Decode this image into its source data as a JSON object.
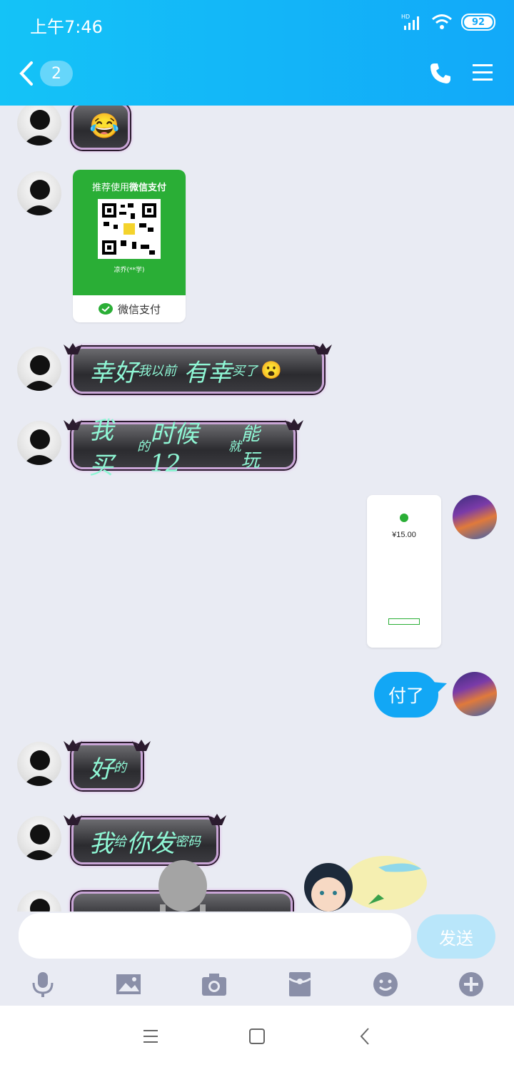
{
  "status_bar": {
    "time": "上午7:46",
    "battery": "92",
    "signal_label": "HD"
  },
  "header": {
    "unread_count": "2"
  },
  "qr_card": {
    "title_prefix": "推荐使用",
    "title_bold": "微信支付",
    "payee": "凉乔(**学)",
    "footer": "微信支付"
  },
  "messages": [
    {
      "sender": "other",
      "type": "sticker-bubble",
      "text": "😂"
    },
    {
      "sender": "other",
      "type": "qr"
    },
    {
      "sender": "other",
      "type": "text",
      "big": "幸好",
      "small": "我以前",
      "big2": "有幸",
      "small2": "买了",
      "emoji": "😮"
    },
    {
      "sender": "other",
      "type": "text",
      "big": "我买",
      "small": "的",
      "big2": "时候12",
      "small2": "就",
      "tail": "能玩"
    },
    {
      "sender": "me",
      "type": "image"
    },
    {
      "sender": "me",
      "type": "text",
      "text": "付了"
    },
    {
      "sender": "other",
      "type": "text",
      "big": "好",
      "small": "的"
    },
    {
      "sender": "other",
      "type": "text",
      "big": "我",
      "small": "给",
      "big2": "你发",
      "small2": "密码"
    }
  ],
  "payment_screenshot": {
    "amount": "¥15.00"
  },
  "input": {
    "placeholder": "",
    "send_label": "发送"
  },
  "colors": {
    "header": "#12a9f9",
    "bubble_me": "#12a7f5",
    "bubble_text": "#8ff7d5"
  }
}
